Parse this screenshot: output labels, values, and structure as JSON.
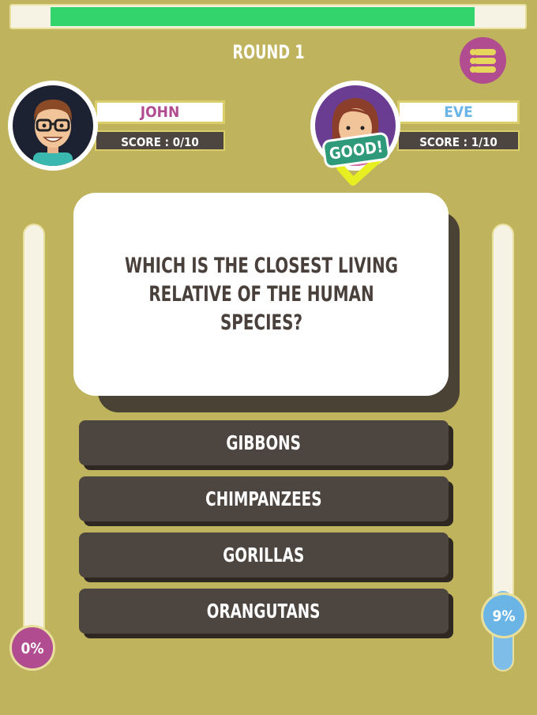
{
  "timer": {
    "progress": 0.86,
    "fill_color": "#33d46c"
  },
  "round": {
    "title": "ROUND 1"
  },
  "menu": {
    "icon": "menu-list-icon",
    "color": "#b04c8f"
  },
  "players": [
    {
      "name": "JOHN",
      "score": "SCORE : 0/10",
      "name_color": "#b04c8f",
      "progress_label": "0%",
      "progress": 0.0,
      "accent": "#b04c8f"
    },
    {
      "name": "EVE",
      "score": "SCORE : 1/10",
      "name_color": "#6bb5e6",
      "progress_label": "9%",
      "progress": 0.09,
      "accent": "#6bb5e6",
      "feedback": "GOOD!"
    }
  ],
  "question": {
    "text": "WHICH IS THE CLOSEST LIVING RELATIVE OF THE HUMAN SPECIES?"
  },
  "answers": [
    "GIBBONS",
    "CHIMPANZEES",
    "GORILLAS",
    "ORANGUTANS"
  ]
}
